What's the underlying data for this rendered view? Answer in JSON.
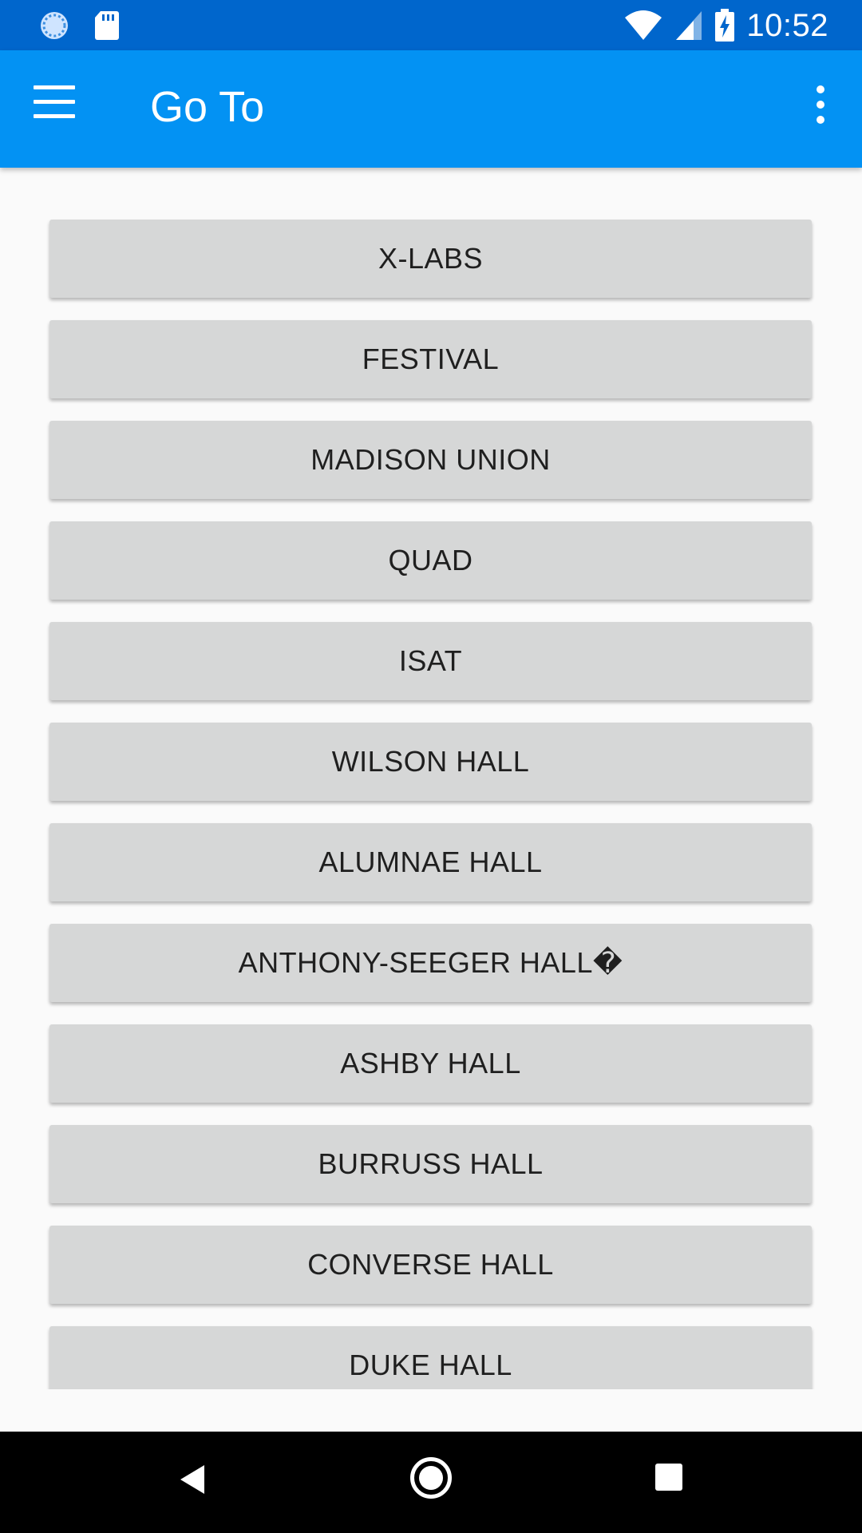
{
  "status_bar": {
    "time": "10:52",
    "icons": [
      "sync-icon",
      "sd-card-icon",
      "wifi-icon",
      "cell-signal-icon",
      "battery-charging-icon"
    ]
  },
  "app_bar": {
    "title": "Go To",
    "menu_icon": "hamburger-menu-icon",
    "overflow_icon": "more-vert-icon",
    "color": "#0392f3"
  },
  "places": [
    "X-LABS",
    "FESTIVAL",
    "MADISON UNION",
    "QUAD",
    "ISAT",
    "WILSON HALL",
    "ALUMNAE HALL",
    "ANTHONY-SEEGER HALL�",
    "ASHBY HALL",
    "BURRUSS HALL",
    "CONVERSE HALL",
    "DUKE HALL"
  ],
  "nav_bar": {
    "icons": [
      "back-icon",
      "home-icon",
      "recents-icon"
    ]
  }
}
